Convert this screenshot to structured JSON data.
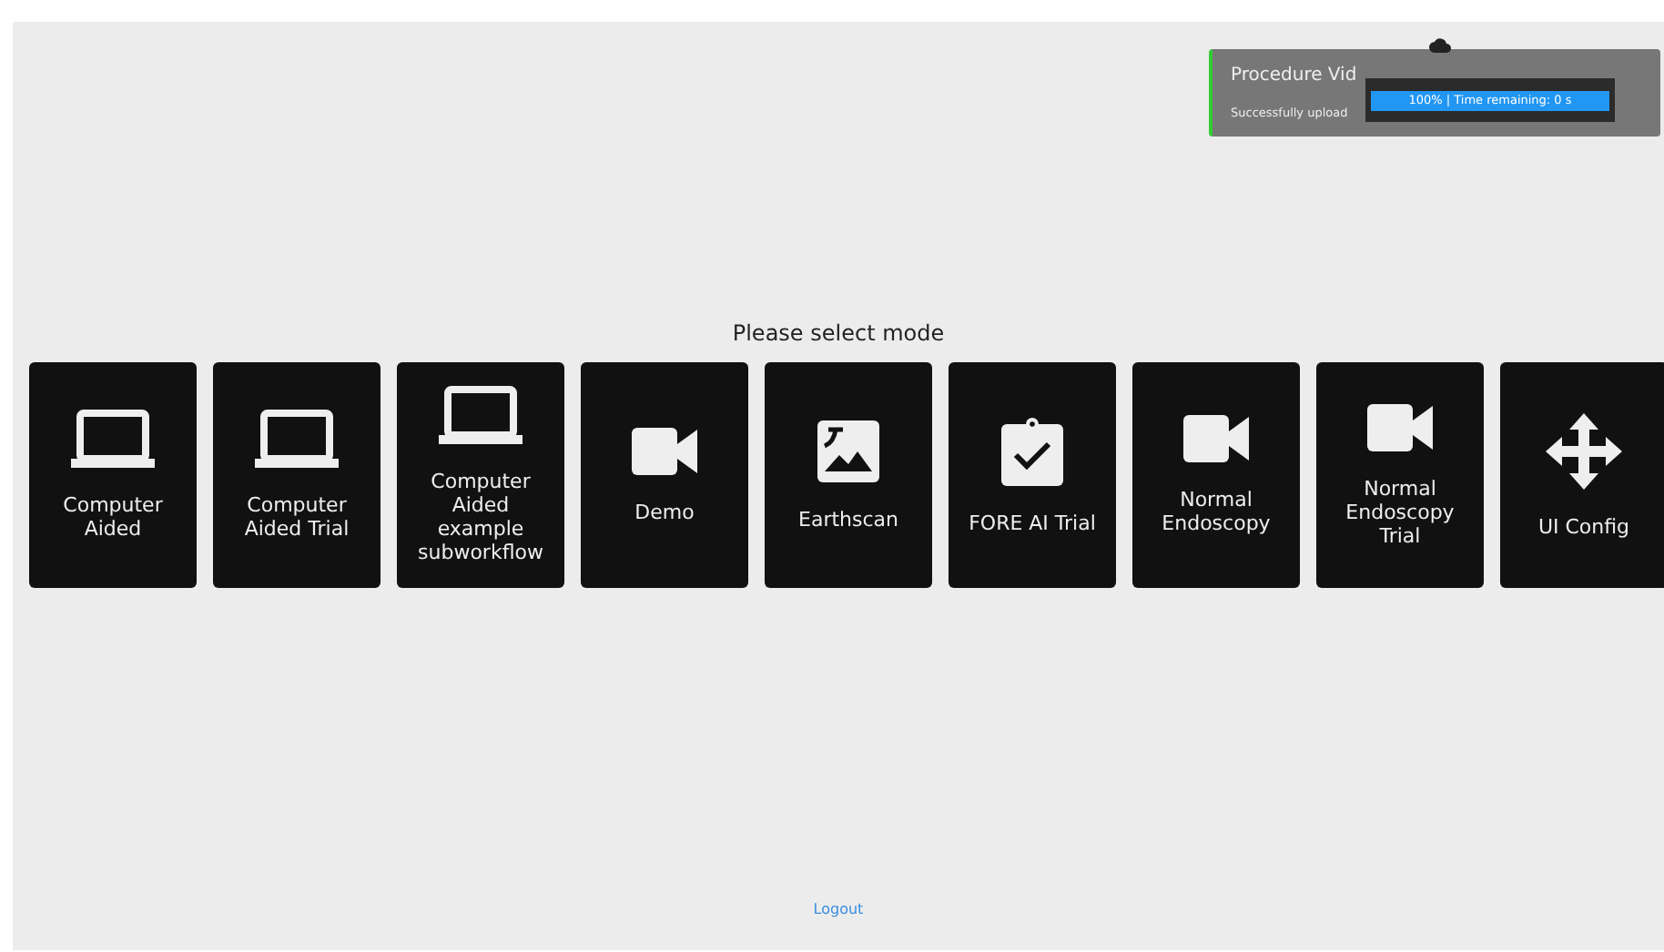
{
  "toast": {
    "title": "Procedure Vid",
    "message": "Successfully upload",
    "progress": {
      "level": 1,
      "text": "100% | Time remaining: 0 s"
    }
  },
  "prompt": "Please select mode",
  "modes": [
    {
      "label": "Computer Aided",
      "kind": "laptop"
    },
    {
      "label": "Computer Aided Trial",
      "kind": "laptop"
    },
    {
      "label": "Computer Aided example subworkflow",
      "kind": "laptop"
    },
    {
      "label": "Demo",
      "kind": "video"
    },
    {
      "label": "Earthscan",
      "kind": "image"
    },
    {
      "label": "FORE AI Trial",
      "kind": "clipboard"
    },
    {
      "label": "Normal Endoscopy",
      "kind": "video"
    },
    {
      "label": "Normal Endoscopy Trial",
      "kind": "video"
    },
    {
      "label": "UI Config",
      "kind": "move"
    }
  ],
  "logout": "Logout"
}
